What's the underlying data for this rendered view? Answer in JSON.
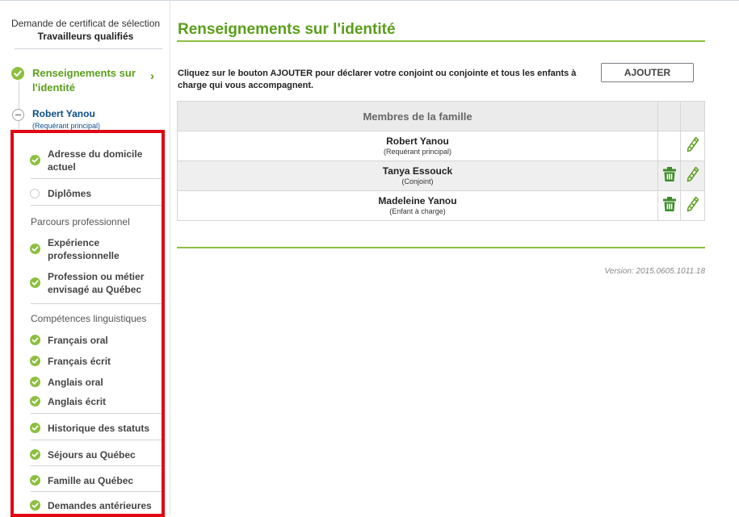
{
  "colors": {
    "accent": "#5a9e1a",
    "check": "#8cbf3f",
    "link": "#0d4f8b",
    "highlight_box": "#e10613"
  },
  "sidebar": {
    "application_title": "Demande de certificat de sélection",
    "program": "Travailleurs qualifiés",
    "current_step": {
      "label": "Renseignements sur l'identité",
      "icon": "check-circle-icon",
      "chevron": "›"
    },
    "person": {
      "name": "Robert Yanou",
      "role": "(Requérant principal)"
    },
    "items": [
      {
        "label": "Adresse du domicile actuel",
        "status": "complete"
      },
      {
        "label": "Diplômes",
        "status": "incomplete"
      }
    ],
    "sections": [
      {
        "title": "Parcours professionnel",
        "items": [
          {
            "label": "Expérience professionnelle",
            "status": "complete"
          },
          {
            "label": "Profession ou métier envisagé au Québec",
            "status": "complete"
          }
        ]
      },
      {
        "title": "Compétences linguistiques",
        "items": [
          {
            "label": "Français oral",
            "status": "complete"
          },
          {
            "label": "Français écrit",
            "status": "complete"
          },
          {
            "label": "Anglais oral",
            "status": "complete"
          },
          {
            "label": "Anglais écrit",
            "status": "complete"
          }
        ]
      }
    ],
    "more_items": [
      {
        "label": "Historique des statuts",
        "status": "complete"
      },
      {
        "label": "Séjours au Québec",
        "status": "complete"
      },
      {
        "label": "Famille au Québec",
        "status": "complete"
      },
      {
        "label": "Demandes antérieures",
        "status": "complete"
      }
    ]
  },
  "main": {
    "title": "Renseignements sur l'identité",
    "instructions": "Cliquez sur le bouton AJOUTER pour déclarer votre conjoint ou conjointe et tous les enfants à charge qui vous accompagnent.",
    "add_button": "AJOUTER",
    "table": {
      "header": "Membres de la famille",
      "rows": [
        {
          "name": "Robert Yanou",
          "role": "(Requérant principal)",
          "icons": [
            "edit-icon"
          ]
        },
        {
          "name": "Tanya Essouck",
          "role": "(Conjoint)",
          "icons": [
            "delete-icon",
            "edit-icon"
          ]
        },
        {
          "name": "Madeleine Yanou",
          "role": "(Enfant à charge)",
          "icons": [
            "delete-icon",
            "edit-icon"
          ]
        }
      ]
    },
    "version": "Version: 2015.0605.1011.18"
  }
}
